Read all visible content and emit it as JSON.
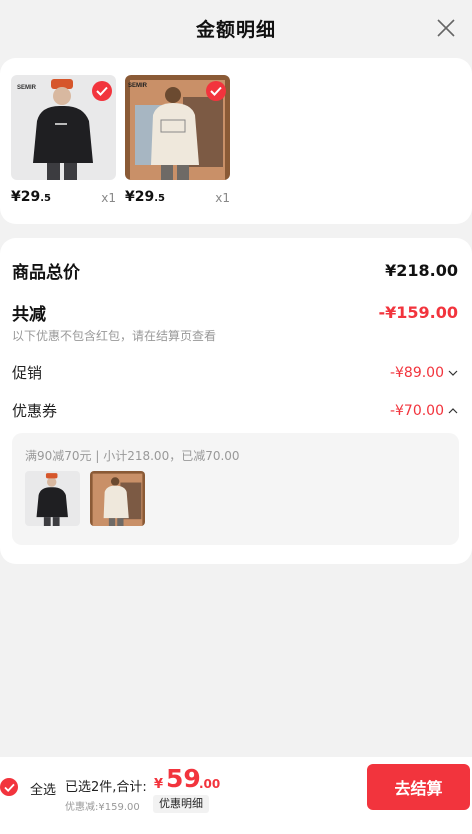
{
  "header": {
    "title": "金额明细",
    "close_icon": "close-icon"
  },
  "products": [
    {
      "price_int": "¥29",
      "price_dec": ".5",
      "qty": "x1",
      "brand": "SEMIR"
    },
    {
      "price_int": "¥29",
      "price_dec": ".5",
      "qty": "x1",
      "brand": "SEMIR"
    }
  ],
  "summary": {
    "total_label": "商品总价",
    "total_value": "¥218.00",
    "reduce_label": "共减",
    "reduce_value": "-¥159.00",
    "note": "以下优惠不包含红包，请在结算页查看",
    "promo_label": "促销",
    "promo_value": "-¥89.00",
    "coupon_label": "优惠券",
    "coupon_value": "-¥70.00",
    "coupon_desc": "满90减70元 | 小计218.00，已减70.00"
  },
  "bottom": {
    "select_all": "全选",
    "selected_text": "已选2件,合计:",
    "total_symbol": "¥",
    "total_int": "59",
    "total_dec": ".00",
    "discount_text": "优惠减:¥159.00",
    "detail_label": "优惠明细",
    "checkout_label": "去结算"
  },
  "colors": {
    "accent": "#f2343d",
    "bg": "#f2f2f2"
  }
}
